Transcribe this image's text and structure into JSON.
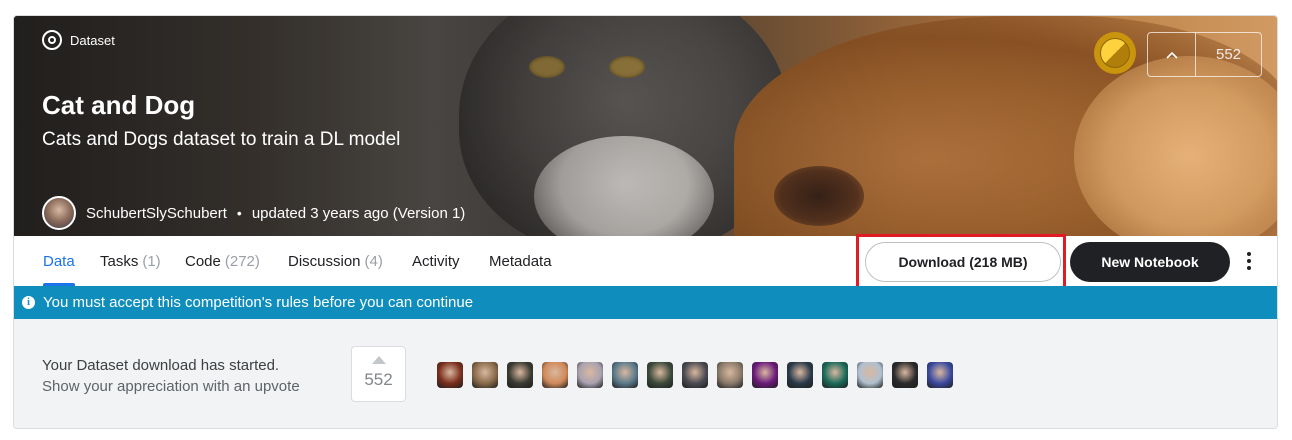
{
  "header": {
    "type_label": "Dataset",
    "title": "Cat and Dog",
    "subtitle": "Cats and Dogs dataset to train a DL model",
    "owner": "SchubertSlySchubert",
    "updated": "updated 3 years ago (Version 1)",
    "upvotes": "552"
  },
  "tabs": [
    {
      "label": "Data",
      "count": "",
      "active": true
    },
    {
      "label": "Tasks",
      "count": "(1)"
    },
    {
      "label": "Code",
      "count": "(272)"
    },
    {
      "label": "Discussion",
      "count": "(4)"
    },
    {
      "label": "Activity",
      "count": ""
    },
    {
      "label": "Metadata",
      "count": ""
    }
  ],
  "actions": {
    "download_label": "Download (218 MB)",
    "new_notebook_label": "New Notebook"
  },
  "banner": {
    "text": "You must accept this competition's rules before you can continue"
  },
  "appreciation": {
    "line1": "Your Dataset download has started.",
    "line2": "Show your appreciation with an upvote",
    "upvotes": "552"
  },
  "voter_colors": [
    "#7a2e1c",
    "#8a6a4a",
    "#3b3a32",
    "#d08a5a",
    "#a9a2b0",
    "#5a7a8a",
    "#3c4a3a",
    "#4a4a52",
    "#8a7a6a",
    "#6a1a7a",
    "#2a3a4a",
    "#1a6a5a",
    "#b0c0d0",
    "#2a2a2a",
    "#3a4aa0"
  ],
  "colors": {
    "accent": "#1a73e8",
    "banner": "#0f8ebe",
    "primary_button": "#202124",
    "highlight_box": "#e01b24"
  }
}
